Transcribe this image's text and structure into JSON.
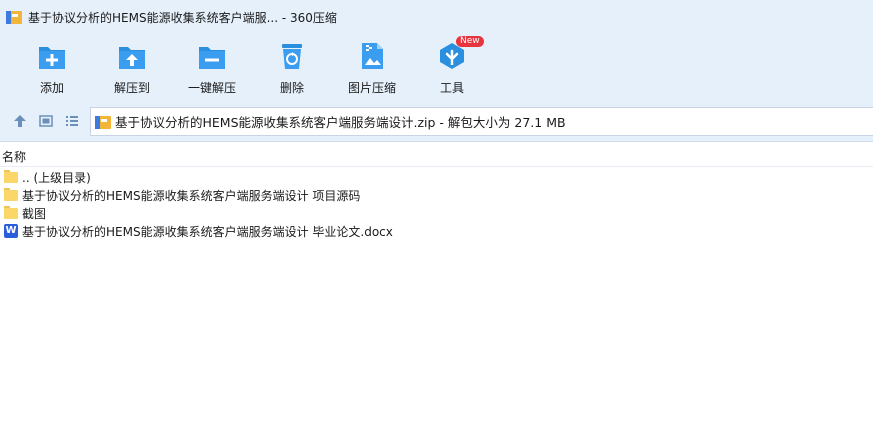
{
  "window": {
    "title": "基于协议分析的HEMS能源收集系统客户端服...  - 360压缩"
  },
  "toolbar": {
    "items": [
      {
        "label": "添加",
        "icon": "add-icon"
      },
      {
        "label": "解压到",
        "icon": "extract-to-icon"
      },
      {
        "label": "一键解压",
        "icon": "one-click-extract-icon"
      },
      {
        "label": "删除",
        "icon": "delete-icon"
      },
      {
        "label": "图片压缩",
        "icon": "image-compress-icon"
      },
      {
        "label": "工具",
        "icon": "tools-icon",
        "badge": "New"
      }
    ]
  },
  "navigation": {
    "path": "基于协议分析的HEMS能源收集系统客户端服务端设计.zip - 解包大小为 27.1 MB"
  },
  "columns": {
    "name": "名称"
  },
  "files": [
    {
      "name": ".. (上级目录)",
      "type": "folder"
    },
    {
      "name": "基于协议分析的HEMS能源收集系统客户端服务端设计 项目源码",
      "type": "folder"
    },
    {
      "name": "截图",
      "type": "folder"
    },
    {
      "name": "基于协议分析的HEMS能源收集系统客户端服务端设计 毕业论文.docx",
      "type": "word"
    }
  ],
  "colors": {
    "accent": "#2b8fe0",
    "toolbar_bg": "#e6f0fb",
    "folder": "#fbd769",
    "badge": "#e8343c"
  }
}
